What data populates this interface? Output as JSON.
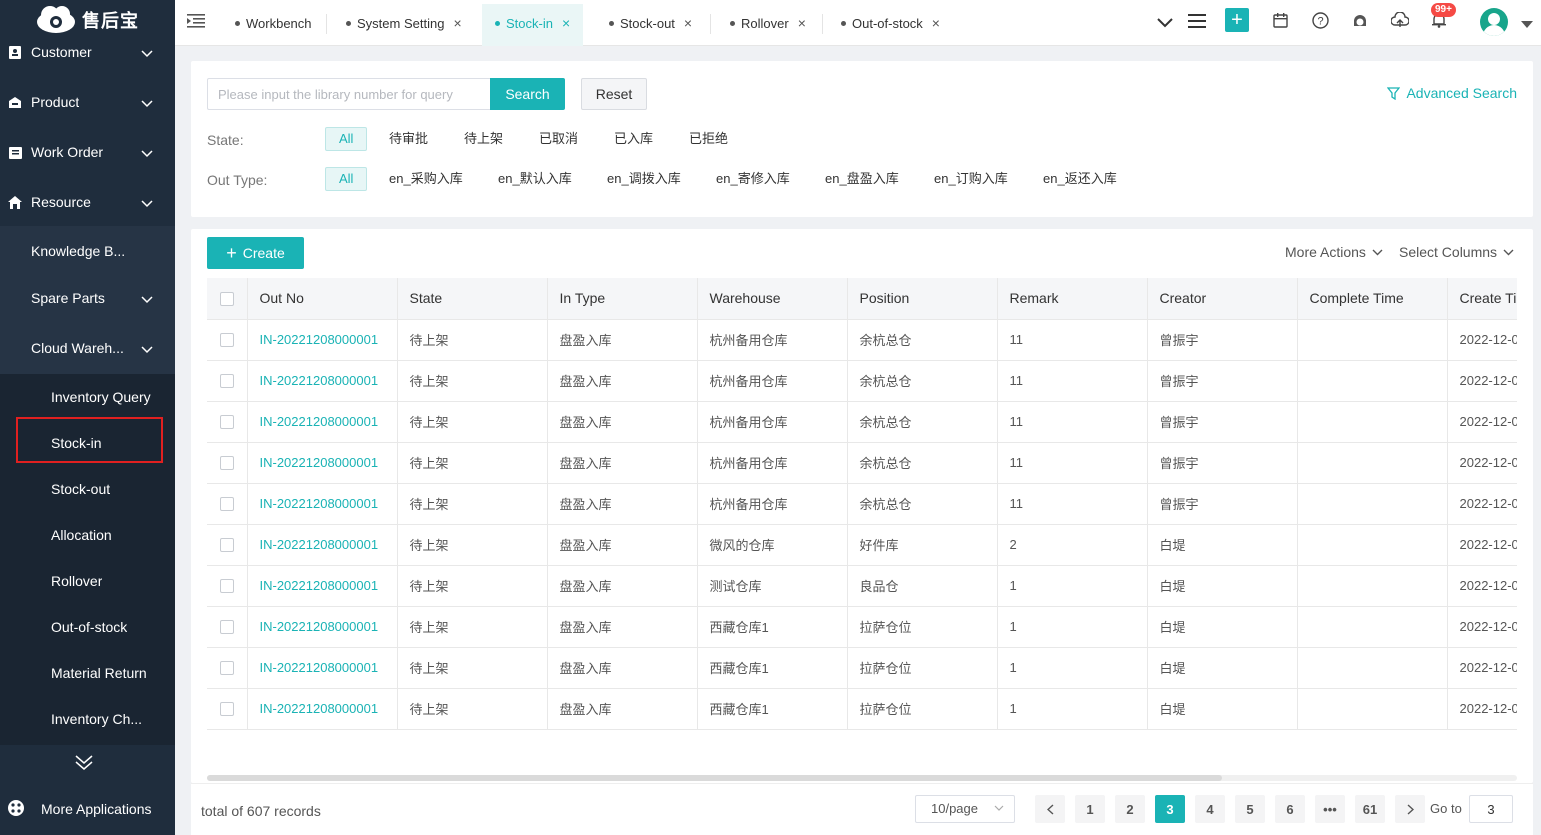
{
  "app": {
    "logo_text": "售后宝"
  },
  "sidebar": {
    "items": [
      {
        "label": "Customer"
      },
      {
        "label": "Product"
      },
      {
        "label": "Work Order"
      },
      {
        "label": "Resource"
      }
    ],
    "resource_children": [
      {
        "label": "Knowledge B..."
      },
      {
        "label": "Spare Parts"
      },
      {
        "label": "Cloud Wareh..."
      }
    ],
    "warehouse_children": [
      {
        "label": "Inventory Query"
      },
      {
        "label": "Stock-in"
      },
      {
        "label": "Stock-out"
      },
      {
        "label": "Allocation"
      },
      {
        "label": "Rollover"
      },
      {
        "label": "Out-of-stock"
      },
      {
        "label": "Material Return"
      },
      {
        "label": "Inventory Ch..."
      }
    ],
    "more_apps": "More Applications"
  },
  "tabs": [
    {
      "label": "Workbench"
    },
    {
      "label": "System Setting"
    },
    {
      "label": "Stock-in"
    },
    {
      "label": "Stock-out"
    },
    {
      "label": "Rollover"
    },
    {
      "label": "Out-of-stock"
    }
  ],
  "topbar": {
    "badge": "99+",
    "accent": "#1ab3b5"
  },
  "filters": {
    "search_placeholder": "Please input the library number for query",
    "search_label": "Search",
    "reset_label": "Reset",
    "advanced_label": "Advanced Search",
    "state_label": "State:",
    "state_options": [
      "All",
      "待审批",
      "待上架",
      "已取消",
      "已入库",
      "已拒绝"
    ],
    "type_label": "Out Type:",
    "type_options": [
      "All",
      "en_采购入库",
      "en_默认入库",
      "en_调拨入库",
      "en_寄修入库",
      "en_盘盈入库",
      "en_订购入库",
      "en_返还入库"
    ]
  },
  "toolbar": {
    "create_label": "Create",
    "more_actions": "More Actions",
    "select_columns": "Select Columns"
  },
  "table": {
    "columns": [
      "Out No",
      "State",
      "In Type",
      "Warehouse",
      "Position",
      "Remark",
      "Creator",
      "Complete Time",
      "Create Ti"
    ],
    "rows": [
      [
        "IN-20221208000001",
        "待上架",
        "盘盈入库",
        "杭州备用仓库",
        "余杭总仓",
        "11",
        "曾振宇",
        "",
        "2022-12-0"
      ],
      [
        "IN-20221208000001",
        "待上架",
        "盘盈入库",
        "杭州备用仓库",
        "余杭总仓",
        "11",
        "曾振宇",
        "",
        "2022-12-0"
      ],
      [
        "IN-20221208000001",
        "待上架",
        "盘盈入库",
        "杭州备用仓库",
        "余杭总仓",
        "11",
        "曾振宇",
        "",
        "2022-12-0"
      ],
      [
        "IN-20221208000001",
        "待上架",
        "盘盈入库",
        "杭州备用仓库",
        "余杭总仓",
        "11",
        "曾振宇",
        "",
        "2022-12-0"
      ],
      [
        "IN-20221208000001",
        "待上架",
        "盘盈入库",
        "杭州备用仓库",
        "余杭总仓",
        "11",
        "曾振宇",
        "",
        "2022-12-0"
      ],
      [
        "IN-20221208000001",
        "待上架",
        "盘盈入库",
        "微风的仓库",
        "好件库",
        "2",
        "白堤",
        "",
        "2022-12-0"
      ],
      [
        "IN-20221208000001",
        "待上架",
        "盘盈入库",
        "测试仓库",
        "良品仓",
        "1",
        "白堤",
        "",
        "2022-12-0"
      ],
      [
        "IN-20221208000001",
        "待上架",
        "盘盈入库",
        "西藏仓库1",
        "拉萨仓位",
        "1",
        "白堤",
        "",
        "2022-12-0"
      ],
      [
        "IN-20221208000001",
        "待上架",
        "盘盈入库",
        "西藏仓库1",
        "拉萨仓位",
        "1",
        "白堤",
        "",
        "2022-12-0"
      ],
      [
        "IN-20221208000001",
        "待上架",
        "盘盈入库",
        "西藏仓库1",
        "拉萨仓位",
        "1",
        "白堤",
        "",
        "2022-12-0"
      ]
    ]
  },
  "pagination": {
    "total_text": "total of 607 records",
    "page_size": "10/page",
    "pages": [
      "1",
      "2",
      "3",
      "4",
      "5",
      "6",
      "•••",
      "61"
    ],
    "current": "3",
    "goto_label": "Go to",
    "goto_value": "3"
  }
}
